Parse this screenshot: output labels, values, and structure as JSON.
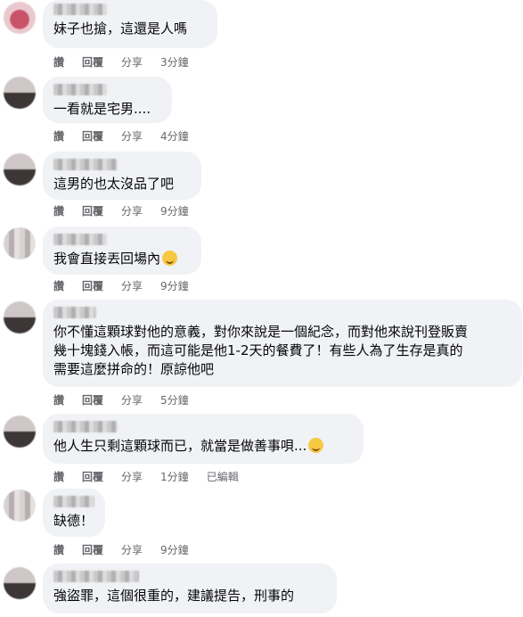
{
  "comments": [
    {
      "text": "妹子也搶，這還是人嗎",
      "actions": {
        "like": "讚",
        "reply": "回覆",
        "share": "分享",
        "time": "3分鐘"
      },
      "emoji": ""
    },
    {
      "text": "一看就是宅男....",
      "actions": {
        "like": "讚",
        "reply": "回覆",
        "share": "分享",
        "time": "4分鐘"
      },
      "emoji": ""
    },
    {
      "text": "這男的也太沒品了吧",
      "actions": {
        "like": "讚",
        "reply": "回覆",
        "share": "分享",
        "time": "9分鐘"
      },
      "emoji": ""
    },
    {
      "text": "我會直接丟回場內",
      "actions": {
        "like": "讚",
        "reply": "回覆",
        "share": "分享",
        "time": "9分鐘"
      },
      "emoji": "rolling-laughing-emoji"
    },
    {
      "text": "你不懂這顆球對他的意義，對你來說是一個紀念，而對他來說刊登販賣\n幾十塊錢入帳，而這可能是他1-2天的餐費了！有些人為了生存是真的\n需要這麼拼命的！原諒他吧",
      "actions": {
        "like": "讚",
        "reply": "回覆",
        "share": "分享",
        "time": "5分鐘"
      },
      "emoji": ""
    },
    {
      "text": "他人生只剩這顆球而已，就當是做善事唄...",
      "actions": {
        "like": "讚",
        "reply": "回覆",
        "share": "分享",
        "time": "1分鐘",
        "edited": "已編輯"
      },
      "emoji": "smiling-emoji"
    },
    {
      "text": "缺德！",
      "actions": {
        "like": "讚",
        "reply": "回覆",
        "share": "分享",
        "time": "9分鐘"
      },
      "emoji": ""
    },
    {
      "text": "強盜罪，這個很重的，建議提告，刑事的",
      "actions": {},
      "emoji": ""
    }
  ]
}
